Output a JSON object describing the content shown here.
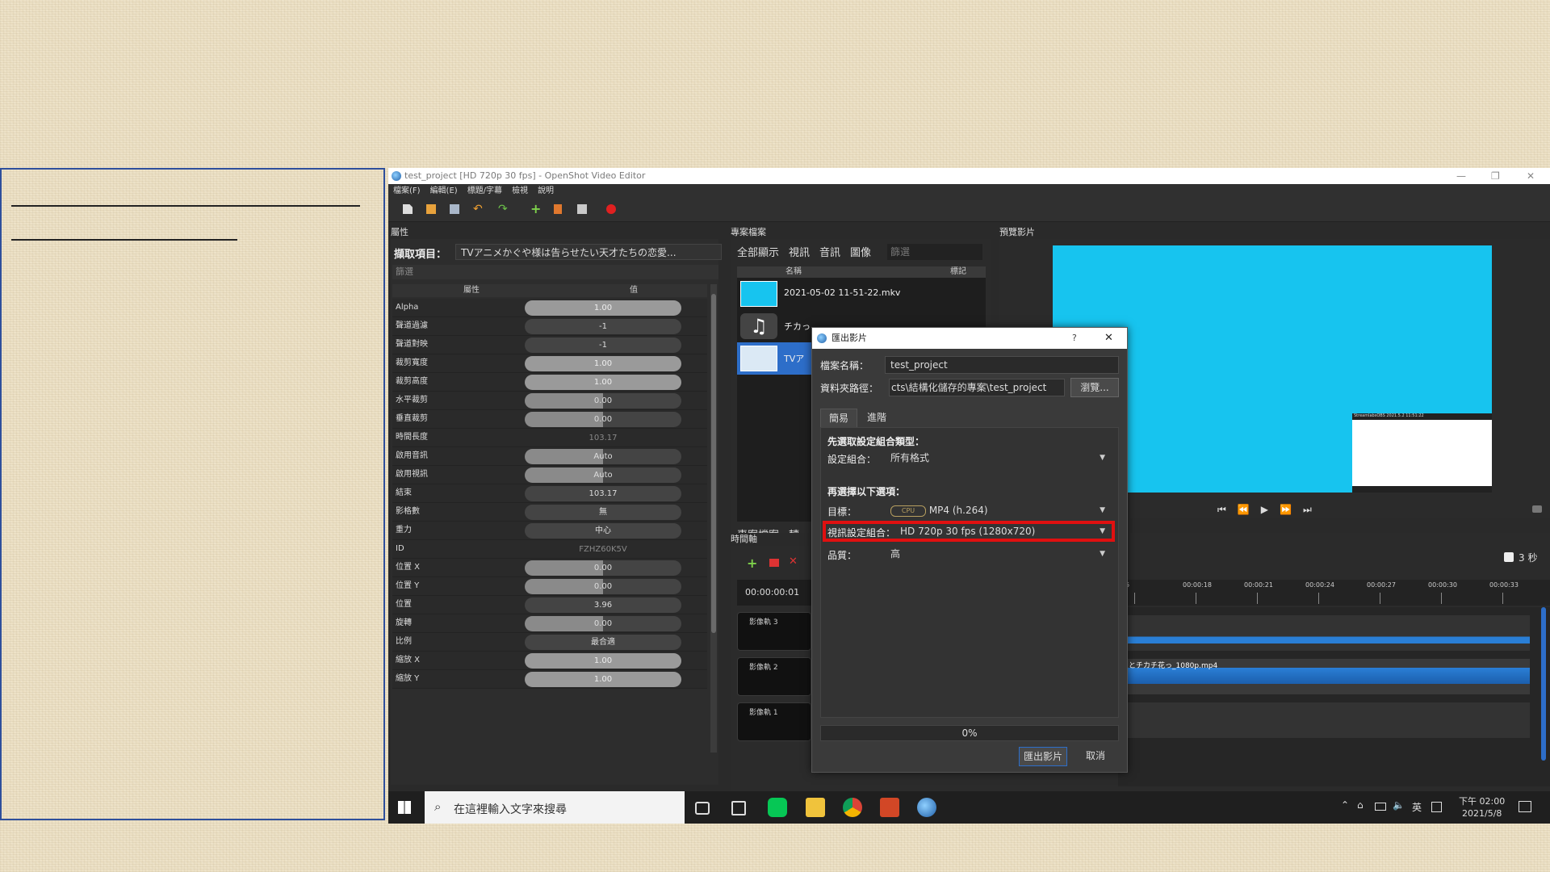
{
  "window": {
    "title": "test_project [HD 720p 30 fps] - OpenShot Video Editor",
    "controls": [
      "—",
      "❐",
      "✕"
    ]
  },
  "menu": [
    "檔案(F)",
    "編輯(E)",
    "標題/字幕",
    "檢視",
    "說明"
  ],
  "properties_panel": {
    "dock_title": "屬性",
    "selection_label": "擷取項目：",
    "selection_value": "TVアニメかぐや様は告らせたい天才たちの恋愛...",
    "filter_placeholder": "篩選",
    "col_property": "屬性",
    "col_value": "值",
    "rows": [
      {
        "name": "Alpha",
        "value": "1.00"
      },
      {
        "name": "聲道過濾",
        "value": "-1"
      },
      {
        "name": "聲道對映",
        "value": "-1"
      },
      {
        "name": "裁剪寬度",
        "value": "1.00"
      },
      {
        "name": "裁剪高度",
        "value": "1.00"
      },
      {
        "name": "水平裁剪",
        "value": "0.00"
      },
      {
        "name": "垂直裁剪",
        "value": "0.00"
      },
      {
        "name": "時間長度",
        "value": "103.17"
      },
      {
        "name": "啟用音訊",
        "value": "Auto"
      },
      {
        "name": "啟用視訊",
        "value": "Auto"
      },
      {
        "name": "結束",
        "value": "103.17"
      },
      {
        "name": "影格數",
        "value": "無"
      },
      {
        "name": "重力",
        "value": "中心"
      },
      {
        "name": "ID",
        "value": "FZHZ60K5V"
      },
      {
        "name": "位置 X",
        "value": "0.00"
      },
      {
        "name": "位置 Y",
        "value": "0.00"
      },
      {
        "name": "位置",
        "value": "3.96"
      },
      {
        "name": "旋轉",
        "value": "0.00"
      },
      {
        "name": "比例",
        "value": "最合適"
      },
      {
        "name": "縮放 X",
        "value": "1.00"
      },
      {
        "name": "縮放 Y",
        "value": "1.00"
      }
    ]
  },
  "files_panel": {
    "dock_title": "專案檔案",
    "tabs": [
      "全部顯示",
      "視訊",
      "音訊",
      "圖像"
    ],
    "filter_placeholder": "篩選",
    "col_name": "名稱",
    "col_tags": "標記",
    "items": [
      {
        "name": "2021-05-02 11-51-22.mkv"
      },
      {
        "name": "チカっ"
      },
      {
        "name": "TVア"
      }
    ],
    "bottom_tabs": [
      "專案檔案",
      "轉"
    ]
  },
  "preview_panel": {
    "dock_title": "預覽影片",
    "inset_text": "StreamlabsOBS  2021.5.2 11:51:22"
  },
  "timeline_panel": {
    "dock_title": "時間軸",
    "timecode": "00:00:00:01",
    "zoom_label": "3 秒",
    "ruler_ticks": [
      "15",
      "00:00:18",
      "00:00:21",
      "00:00:24",
      "00:00:27",
      "00:00:30",
      "00:00:33",
      "00"
    ],
    "tracks": [
      "影像軌 3",
      "影像軌 2",
      "影像軌 1"
    ],
    "clip_label": "っとチカチ花っ_1080p.mp4"
  },
  "export_dialog": {
    "title": "匯出影片",
    "help": "?",
    "close": "✕",
    "filename_label": "檔案名稱：",
    "filename_value": "test_project",
    "folder_label": "資料夾路徑：",
    "folder_value": "cts\\結構化儲存的專案\\test_project",
    "browse_label": "瀏覽...",
    "tab_simple": "簡易",
    "tab_advanced": "進階",
    "section1": "先選取設定組合類型：",
    "preset_label": "設定組合：",
    "preset_value": "所有格式",
    "section2": "再選擇以下選項：",
    "target_label": "目標：",
    "target_badge": "CPU",
    "target_value": "MP4 (h.264)",
    "video_profile_label": "視訊設定組合：",
    "video_profile_value": "HD 720p 30 fps (1280x720)",
    "quality_label": "品質：",
    "quality_value": "高",
    "progress": "0%",
    "export_button": "匯出影片",
    "cancel_button": "取消",
    "highlight_color": "#e01010"
  },
  "taskbar": {
    "search_placeholder": "在這裡輸入文字來搜尋",
    "time": "下午 02:00",
    "date": "2021/5/8",
    "tray_lang": "英"
  },
  "colors": {
    "preview_cyan": "#17c4ef",
    "selection_blue": "#2d6ec9",
    "waveform_blue": "#2a7fd6",
    "slide_border": "#2e4f9c"
  }
}
